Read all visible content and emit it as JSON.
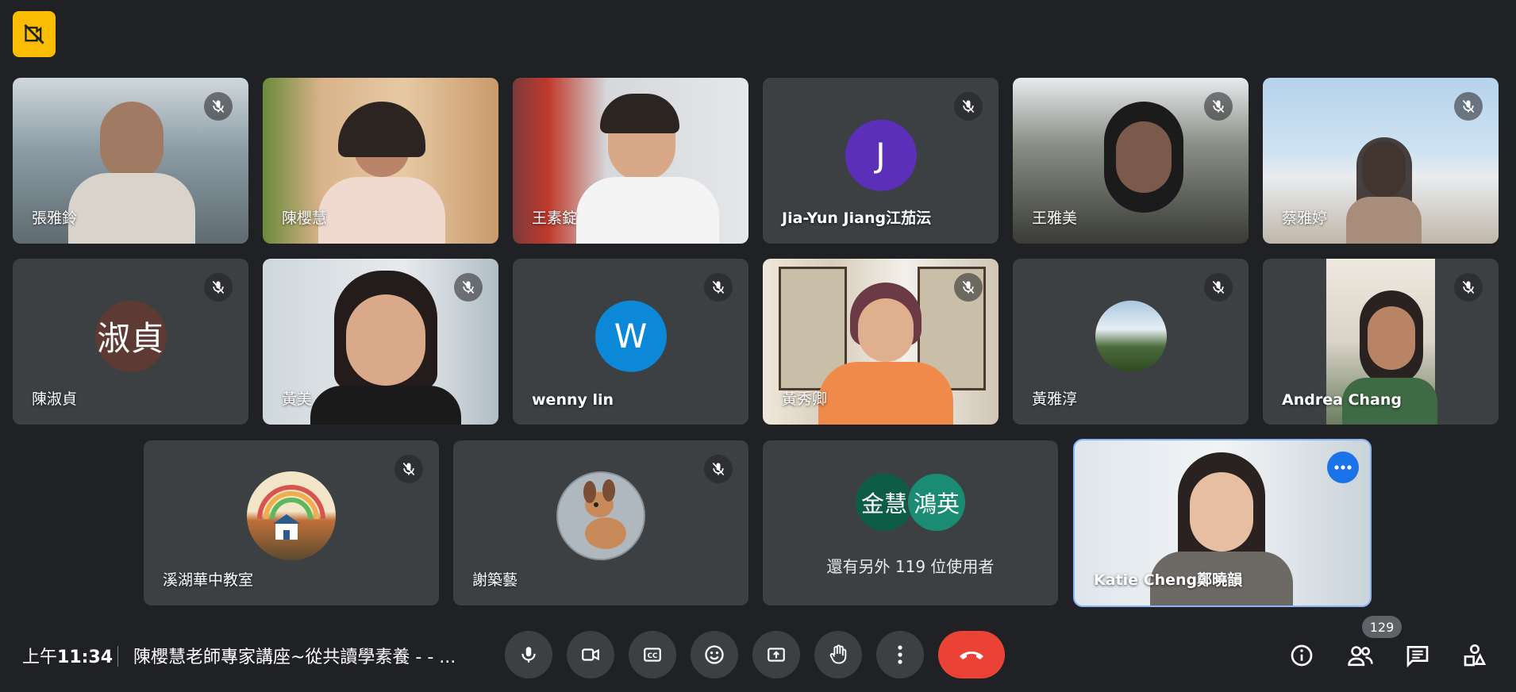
{
  "colors": {
    "background": "#202124",
    "tile": "#3c4043",
    "accent_blue": "#1a73e8",
    "end_call": "#ea4335",
    "recording_badge": "#fbbc04"
  },
  "participants": [
    {
      "name": "張雅鈴",
      "muted": true,
      "type": "video"
    },
    {
      "name": "陳櫻慧",
      "muted": false,
      "type": "video"
    },
    {
      "name": "王素錠",
      "muted": false,
      "type": "video"
    },
    {
      "name": "Jia-Yun Jiang江茄沄",
      "muted": true,
      "type": "avatar",
      "avatar_text": "J",
      "avatar_color": "#5b2fb8"
    },
    {
      "name": "王雅美",
      "muted": true,
      "type": "video"
    },
    {
      "name": "蔡雅婷",
      "muted": true,
      "type": "video"
    },
    {
      "name": "陳淑貞",
      "muted": true,
      "type": "avatar",
      "avatar_text": "淑貞",
      "avatar_color": "#5d3a33"
    },
    {
      "name": "黃美",
      "muted": true,
      "type": "video"
    },
    {
      "name": "wenny lin",
      "muted": true,
      "type": "avatar",
      "avatar_text": "W",
      "avatar_color": "#0b88d8"
    },
    {
      "name": "黃秀卿",
      "muted": true,
      "type": "video"
    },
    {
      "name": "黃雅淳",
      "muted": true,
      "type": "avatar-image"
    },
    {
      "name": "Andrea Chang",
      "muted": true,
      "type": "video"
    },
    {
      "name": "溪湖華中教室",
      "muted": true,
      "type": "avatar-image"
    },
    {
      "name": "謝築藝",
      "muted": true,
      "type": "avatar-image"
    },
    {
      "name": "Katie Cheng鄭曉韻",
      "muted": false,
      "type": "video",
      "self": true
    }
  ],
  "others": {
    "avatars": [
      "金慧",
      "鴻英"
    ],
    "text": "還有另外 119 位使用者"
  },
  "bottom_bar": {
    "time_prefix": "上午",
    "time": "11:34",
    "meeting_title": "陳櫻慧老師專家講座~從共讀學素養 -  - ...",
    "participant_count": "129"
  },
  "icons": {
    "recording": "no-camera-icon",
    "mic": "mic-icon",
    "camera": "camera-icon",
    "captions": "captions-icon",
    "emoji": "emoji-icon",
    "present": "present-icon",
    "hand": "raise-hand-icon",
    "more": "more-vert-icon",
    "end": "end-call-icon",
    "info": "info-icon",
    "people": "people-icon",
    "chat": "chat-icon",
    "activities": "activities-icon"
  }
}
